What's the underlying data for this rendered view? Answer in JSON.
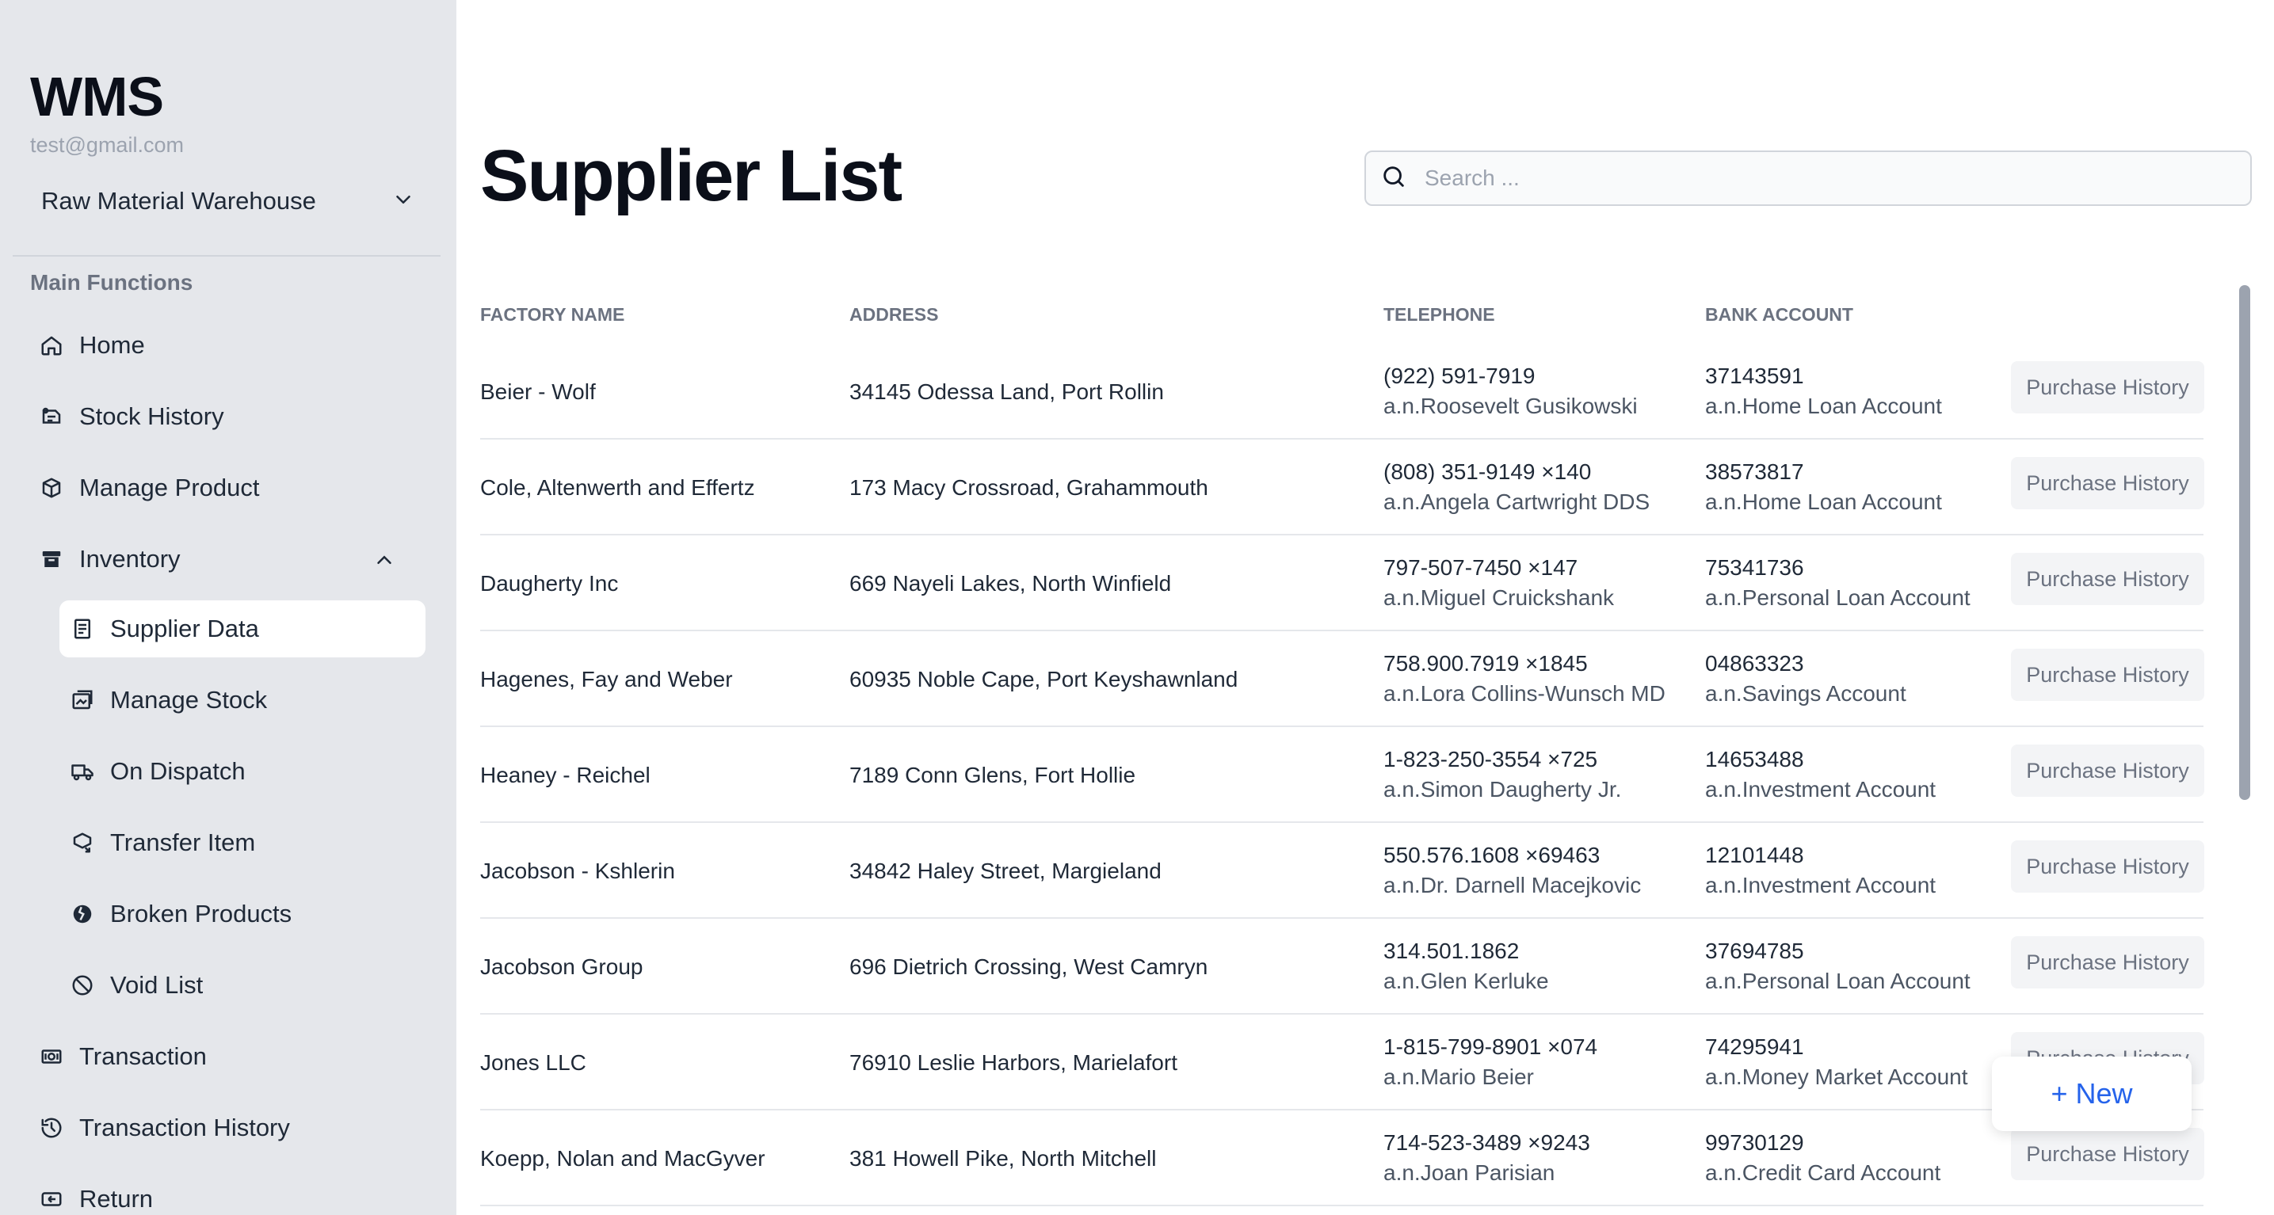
{
  "app": {
    "brand": "WMS",
    "email": "test@gmail.com"
  },
  "warehouse": {
    "selected": "Raw Material Warehouse"
  },
  "sidebar": {
    "section_title": "Main Functions",
    "items": [
      {
        "label": "Home",
        "icon": "home-icon"
      },
      {
        "label": "Stock History",
        "icon": "stock-history-icon"
      },
      {
        "label": "Manage Product",
        "icon": "box-icon"
      },
      {
        "label": "Inventory",
        "icon": "archive-icon"
      },
      {
        "label": "Supplier Data",
        "icon": "document-icon"
      },
      {
        "label": "Manage Stock",
        "icon": "stack-icon"
      },
      {
        "label": "On Dispatch",
        "icon": "truck-icon"
      },
      {
        "label": "Transfer Item",
        "icon": "transfer-icon"
      },
      {
        "label": "Broken Products",
        "icon": "broken-icon"
      },
      {
        "label": "Void List",
        "icon": "ban-icon"
      },
      {
        "label": "Transaction",
        "icon": "cash-icon"
      },
      {
        "label": "Transaction History",
        "icon": "history-icon"
      },
      {
        "label": "Return",
        "icon": "return-icon"
      }
    ]
  },
  "main": {
    "title": "Supplier List",
    "search_placeholder": "Search ...",
    "columns": [
      "FACTORY NAME",
      "ADDRESS",
      "TELEPHONE",
      "BANK ACCOUNT"
    ],
    "action_label": "Purchase History",
    "new_label": "+ New",
    "rows": [
      {
        "name": "Beier - Wolf",
        "address": "34145 Odessa Land, Port Rollin",
        "phone": "(922) 591-7919",
        "contact": "a.n.Roosevelt Gusikowski",
        "account": "37143591",
        "account_type": "a.n.Home Loan Account"
      },
      {
        "name": "Cole, Altenwerth and Effertz",
        "address": "173 Macy Crossroad, Grahammouth",
        "phone": "(808) 351-9149 ×140",
        "contact": "a.n.Angela Cartwright DDS",
        "account": "38573817",
        "account_type": "a.n.Home Loan Account"
      },
      {
        "name": "Daugherty Inc",
        "address": "669 Nayeli Lakes, North Winfield",
        "phone": "797-507-7450 ×147",
        "contact": "a.n.Miguel Cruickshank",
        "account": "75341736",
        "account_type": "a.n.Personal Loan Account"
      },
      {
        "name": "Hagenes, Fay and Weber",
        "address": "60935 Noble Cape, Port Keyshawnland",
        "phone": "758.900.7919 ×1845",
        "contact": "a.n.Lora Collins-Wunsch MD",
        "account": "04863323",
        "account_type": "a.n.Savings Account"
      },
      {
        "name": "Heaney - Reichel",
        "address": "7189 Conn Glens, Fort Hollie",
        "phone": "1-823-250-3554 ×725",
        "contact": "a.n.Simon Daugherty Jr.",
        "account": "14653488",
        "account_type": "a.n.Investment Account"
      },
      {
        "name": "Jacobson - Kshlerin",
        "address": "34842 Haley Street, Margieland",
        "phone": "550.576.1608 ×69463",
        "contact": "a.n.Dr. Darnell Macejkovic",
        "account": "12101448",
        "account_type": "a.n.Investment Account"
      },
      {
        "name": "Jacobson Group",
        "address": "696 Dietrich Crossing, West Camryn",
        "phone": "314.501.1862",
        "contact": "a.n.Glen Kerluke",
        "account": "37694785",
        "account_type": "a.n.Personal Loan Account"
      },
      {
        "name": "Jones LLC",
        "address": "76910 Leslie Harbors, Marielafort",
        "phone": "1-815-799-8901 ×074",
        "contact": "a.n.Mario Beier",
        "account": "74295941",
        "account_type": "a.n.Money Market Account"
      },
      {
        "name": "Koepp, Nolan and MacGyver",
        "address": "381 Howell Pike, North Mitchell",
        "phone": "714-523-3489 ×9243",
        "contact": "a.n.Joan Parisian",
        "account": "99730129",
        "account_type": "a.n.Credit Card Account"
      }
    ]
  }
}
